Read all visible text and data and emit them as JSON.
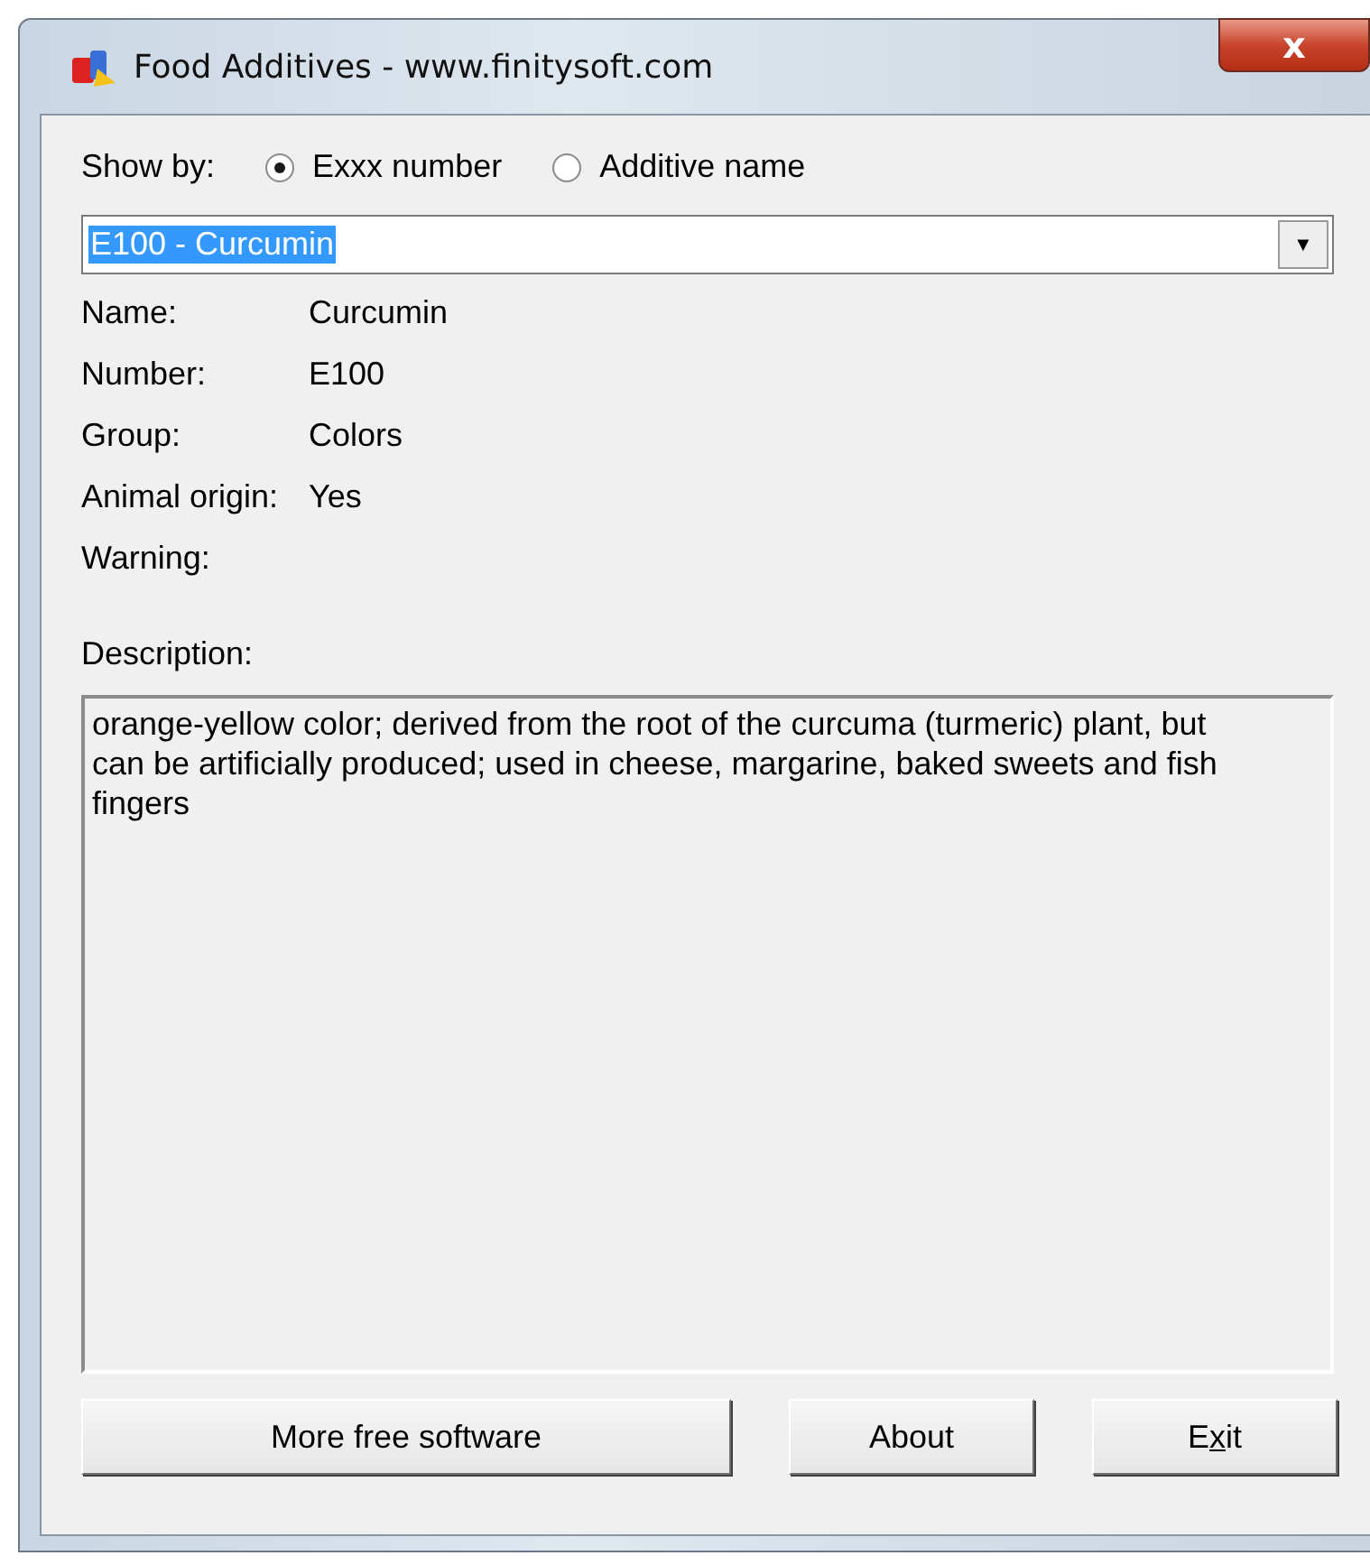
{
  "window": {
    "title": "Food Additives - www.finitysoft.com",
    "close_label": "x"
  },
  "show_by": {
    "label": "Show by:",
    "options": [
      {
        "label": "Exxx number",
        "selected": true
      },
      {
        "label": "Additive name",
        "selected": false
      }
    ]
  },
  "combo": {
    "value": "E100 - Curcumin",
    "arrow": "▼"
  },
  "fields": [
    {
      "label": "Name:",
      "value": "Curcumin"
    },
    {
      "label": "Number:",
      "value": "E100"
    },
    {
      "label": "Group:",
      "value": "Colors"
    },
    {
      "label": "Animal origin:",
      "value": "Yes"
    },
    {
      "label": "Warning:"
    }
  ],
  "description": {
    "label": "Description:",
    "text": "orange-yellow color; derived from the root of the curcuma (turmeric) plant, but can be artificially produced; used in cheese, margarine, baked sweets and fish fingers"
  },
  "buttons": [
    {
      "label": "More free software",
      "kind": "wide"
    },
    {
      "label": "About",
      "kind": "normal"
    },
    {
      "label_parts": [
        {
          "text": "E",
          "underlined": false
        },
        {
          "text": "x",
          "underlined": true
        },
        {
          "text": "it",
          "underlined": false
        }
      ],
      "kind": "normal"
    }
  ]
}
